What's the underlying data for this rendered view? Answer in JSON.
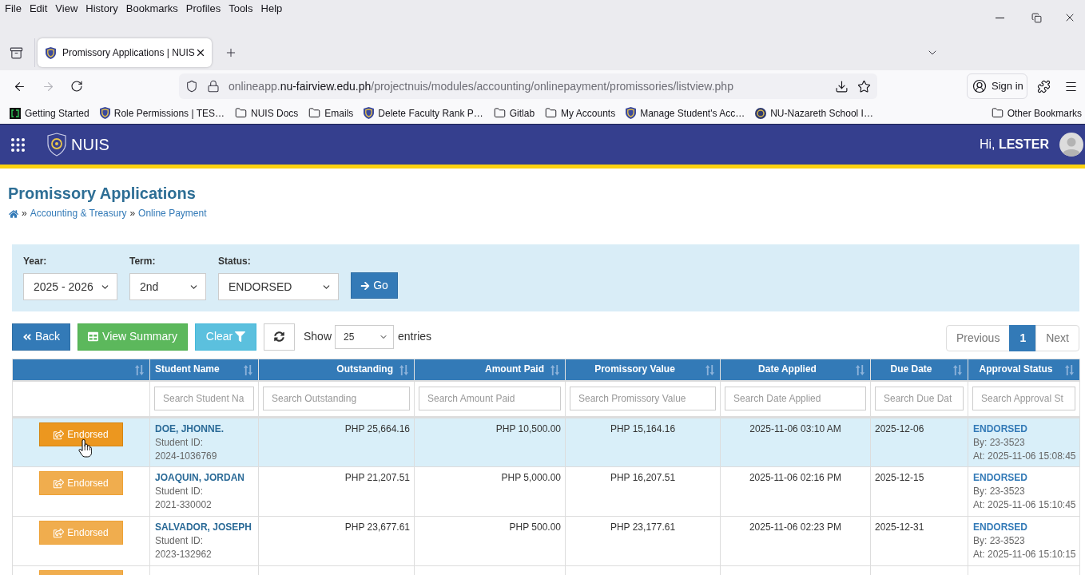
{
  "browser": {
    "menu": [
      "File",
      "Edit",
      "View",
      "History",
      "Bookmarks",
      "Profiles",
      "Tools",
      "Help"
    ],
    "tabs": [
      {
        "title": "Promissory Applications | NUIS",
        "selected": true
      }
    ],
    "forward_disabled": true,
    "address": {
      "host": "onlineapp.",
      "domain": "nu-fairview.edu.ph",
      "path": "/projectnuis/modules/accounting/onlinepayment/promissories/listview.php"
    },
    "sign_in": "Sign in",
    "bookmarks": [
      {
        "label": "Getting Started",
        "kind": "terminal"
      },
      {
        "label": "Role Permissions | TES…",
        "kind": "shield"
      },
      {
        "label": "NUIS Docs",
        "kind": "folder"
      },
      {
        "label": "Emails",
        "kind": "folder"
      },
      {
        "label": "Delete Faculty Rank P…",
        "kind": "shield"
      },
      {
        "label": "Gitlab",
        "kind": "folder"
      },
      {
        "label": "My Accounts",
        "kind": "folder"
      },
      {
        "label": "Manage Student's Acc…",
        "kind": "shield"
      },
      {
        "label": "NU-Nazareth School I…",
        "kind": "seal"
      }
    ],
    "other_bookmarks": "Other Bookmarks"
  },
  "header": {
    "app_name": "NUIS",
    "greeting": "Hi, **LESTER**"
  },
  "page": {
    "title": "Promissory Applications",
    "breadcrumb": [
      {
        "kind": "home"
      },
      {
        "kind": "separator",
        "text": "»"
      },
      {
        "kind": "link",
        "text": "Accounting & Treasury"
      },
      {
        "kind": "separator",
        "text": "»"
      },
      {
        "kind": "link",
        "text": "Online Payment"
      }
    ]
  },
  "filters": [
    {
      "label": "Year:",
      "value": "2025 - 2026"
    },
    {
      "label": "Term:",
      "value": "2nd"
    },
    {
      "label": "Status:",
      "value": "ENDORSED"
    }
  ],
  "go_button": "Go",
  "toolbar": {
    "back": "Back",
    "view_summary": "View Summary",
    "clear": "Clear",
    "show_label": "Show",
    "page_size": "25",
    "entries_label": "entries"
  },
  "pagination": [
    {
      "label": "Previous",
      "selected": false
    },
    {
      "label": "1",
      "selected": true
    },
    {
      "label": "Next",
      "selected": false
    }
  ],
  "table": {
    "columns": [
      {
        "label": "Student Name",
        "placeholder": "Search Student Na"
      },
      {
        "label": "Outstanding",
        "placeholder": "Search Outstanding"
      },
      {
        "label": "Amount Paid",
        "placeholder": "Search Amount Paid"
      },
      {
        "label": "Promissory Value",
        "placeholder": "Search Promissory Value"
      },
      {
        "label": "Date Applied",
        "placeholder": "Search Date Applied"
      },
      {
        "label": "Due Date",
        "placeholder": "Search Due Dat"
      },
      {
        "label": "Approval Status",
        "placeholder": "Search Approval St"
      }
    ],
    "rows": [
      {
        "highlighted": true,
        "action": "Endorsed",
        "student": {
          "name": "DOE, JHONNE.",
          "id_label": "Student ID:",
          "id": "2024-1036769"
        },
        "outstanding": "PHP 25,664.16",
        "amount_paid": "PHP 10,500.00",
        "promissory_value": "PHP 15,164.16",
        "date_applied": "2025-11-06 03:10 AM",
        "due_date": "2025-12-06",
        "approval": {
          "status": "ENDORSED",
          "by": "By: 23-3523",
          "at": "At: 2025-11-06 15:08:45"
        }
      },
      {
        "highlighted": false,
        "action": "Endorsed",
        "student": {
          "name": "JOAQUIN, JORDAN",
          "id_label": "Student ID:",
          "id": "2021-330002"
        },
        "outstanding": "PHP 21,207.51",
        "amount_paid": "PHP 5,000.00",
        "promissory_value": "PHP 16,207.51",
        "date_applied": "2025-11-06 02:16 PM",
        "due_date": "2025-12-15",
        "approval": {
          "status": "ENDORSED",
          "by": "By: 23-3523",
          "at": "At: 2025-11-06 15:10:45"
        }
      },
      {
        "highlighted": false,
        "action": "Endorsed",
        "student": {
          "name": "SALVADOR, JOSEPH",
          "id_label": "Student ID:",
          "id": "2023-132962"
        },
        "outstanding": "PHP 23,677.61",
        "amount_paid": "PHP 500.00",
        "promissory_value": "PHP 23,177.61",
        "date_applied": "2025-11-06 02:23 PM",
        "due_date": "2025-12-31",
        "approval": {
          "status": "ENDORSED",
          "by": "By: 23-3523",
          "at": "At: 2025-11-06 15:10:15"
        }
      },
      {
        "highlighted": false
      }
    ]
  }
}
